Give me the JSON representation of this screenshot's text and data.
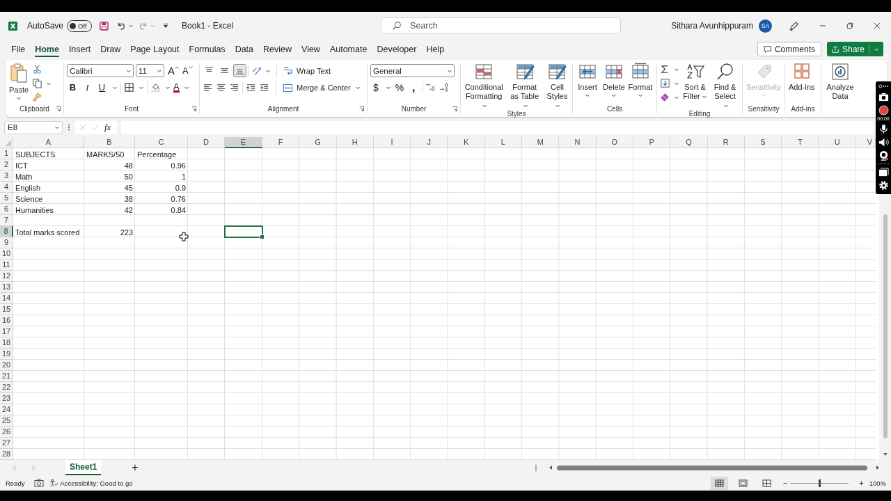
{
  "title_bar": {
    "autosave_label": "AutoSave",
    "autosave": {
      "on": false,
      "text": "Off"
    },
    "document": "Book1  -  Excel",
    "search": {
      "placeholder": "Search"
    },
    "user": "Sithara Avunhippuram",
    "avatar": "SA"
  },
  "menu": {
    "tabs": [
      {
        "label": "File",
        "selected": false
      },
      {
        "label": "Home",
        "selected": true
      },
      {
        "label": "Insert",
        "selected": false
      },
      {
        "label": "Draw",
        "selected": false
      },
      {
        "label": "Page Layout",
        "selected": false
      },
      {
        "label": "Formulas",
        "selected": false
      },
      {
        "label": "Data",
        "selected": false
      },
      {
        "label": "Review",
        "selected": false
      },
      {
        "label": "View",
        "selected": false
      },
      {
        "label": "Automate",
        "selected": false
      },
      {
        "label": "Developer",
        "selected": false
      },
      {
        "label": "Help",
        "selected": false
      }
    ],
    "comments": "Comments",
    "share": "Share"
  },
  "ribbon": {
    "clipboard": {
      "label": "Clipboard",
      "paste": "Paste"
    },
    "font": {
      "label": "Font",
      "name": "Calibri",
      "size": "11",
      "grow": "A",
      "shrink": "A",
      "styles": [
        "B",
        "I",
        "U"
      ],
      "color_letter": "A"
    },
    "alignment": {
      "label": "Alignment",
      "vertical": [
        {
          "selected": false
        },
        {
          "selected": false
        },
        {
          "selected": true
        }
      ],
      "wrap": "Wrap Text",
      "merge": "Merge & Center"
    },
    "number": {
      "label": "Number",
      "format": "General",
      "symbols": [
        "$",
        "%",
        ","
      ]
    },
    "styles": {
      "label": "Styles",
      "buttons": [
        {
          "label": "Conditional Formatting",
          "dropdown": true
        },
        {
          "label": "Format as Table",
          "dropdown": true
        },
        {
          "label": "Cell Styles",
          "dropdown": true
        }
      ]
    },
    "cells": {
      "label": "Cells",
      "buttons": [
        {
          "label": "Insert",
          "dropdown": true
        },
        {
          "label": "Delete",
          "dropdown": true
        },
        {
          "label": "Format",
          "dropdown": true
        }
      ]
    },
    "editing": {
      "label": "Editing",
      "buttons": [
        {
          "label": "Sort & Filter",
          "dropdown": true
        },
        {
          "label": "Find & Select",
          "dropdown": true
        }
      ]
    },
    "sensitivity": {
      "label": "Sensitivity",
      "button": "Sensitivity",
      "disabled": true
    },
    "addins": {
      "label": "Add-ins",
      "button": "Add-ins"
    },
    "analyze": {
      "button": "Analyze Data"
    }
  },
  "formula_bar": {
    "name_box": "E8",
    "fx": "fx"
  },
  "grid": {
    "columns": [
      {
        "label": "A",
        "selected": false
      },
      {
        "label": "B",
        "selected": false
      },
      {
        "label": "C",
        "selected": false
      },
      {
        "label": "D",
        "selected": false
      },
      {
        "label": "E",
        "selected": true
      },
      {
        "label": "F",
        "selected": false
      },
      {
        "label": "G",
        "selected": false
      },
      {
        "label": "H",
        "selected": false
      },
      {
        "label": "I",
        "selected": false
      },
      {
        "label": "J",
        "selected": false
      },
      {
        "label": "K",
        "selected": false
      },
      {
        "label": "L",
        "selected": false
      },
      {
        "label": "M",
        "selected": false
      },
      {
        "label": "N",
        "selected": false
      },
      {
        "label": "O",
        "selected": false
      },
      {
        "label": "P",
        "selected": false
      },
      {
        "label": "Q",
        "selected": false
      },
      {
        "label": "R",
        "selected": false
      },
      {
        "label": "S",
        "selected": false
      },
      {
        "label": "T",
        "selected": false
      },
      {
        "label": "U",
        "selected": false
      },
      {
        "label": "V",
        "selected": false
      }
    ],
    "rows": [
      {
        "number": "1",
        "selected": false,
        "cells": [
          "SUBJECTS",
          "MARKS/50",
          "Percentage"
        ]
      },
      {
        "number": "2",
        "selected": false,
        "cells": [
          "ICT",
          "48",
          "0.96"
        ]
      },
      {
        "number": "3",
        "selected": false,
        "cells": [
          "Math",
          "50",
          "1"
        ]
      },
      {
        "number": "4",
        "selected": false,
        "cells": [
          "English",
          "45",
          "0.9"
        ]
      },
      {
        "number": "5",
        "selected": false,
        "cells": [
          "Science",
          "38",
          "0.76"
        ]
      },
      {
        "number": "6",
        "selected": false,
        "cells": [
          "Humanities",
          "42",
          "0.84"
        ]
      },
      {
        "number": "7",
        "selected": false
      },
      {
        "number": "8",
        "selected": true,
        "cells": [
          "Total marks scored",
          "223"
        ]
      },
      {
        "number": "9",
        "selected": false
      },
      {
        "number": "10",
        "selected": false
      },
      {
        "number": "11",
        "selected": false
      },
      {
        "number": "12",
        "selected": false
      },
      {
        "number": "13",
        "selected": false
      },
      {
        "number": "14",
        "selected": false
      },
      {
        "number": "15",
        "selected": false
      },
      {
        "number": "16",
        "selected": false
      },
      {
        "number": "17",
        "selected": false
      },
      {
        "number": "18",
        "selected": false
      },
      {
        "number": "19",
        "selected": false
      },
      {
        "number": "20",
        "selected": false
      },
      {
        "number": "21",
        "selected": false
      },
      {
        "number": "22",
        "selected": false
      },
      {
        "number": "23",
        "selected": false
      },
      {
        "number": "24",
        "selected": false
      },
      {
        "number": "25",
        "selected": false
      },
      {
        "number": "26",
        "selected": false
      },
      {
        "number": "27",
        "selected": false
      },
      {
        "number": "28",
        "selected": false
      }
    ]
  },
  "sheets": {
    "tabs": [
      {
        "name": "Sheet1",
        "selected": true
      }
    ],
    "add": "+"
  },
  "status_bar": {
    "ready": "Ready",
    "accessibility": "Accessibility: Good to go",
    "views": [
      {
        "selected": true
      },
      {
        "selected": false
      },
      {
        "selected": false
      }
    ],
    "zoom": {
      "level": 0.5,
      "minus": "−",
      "plus": "+",
      "reading": "100%"
    }
  },
  "recorder": {
    "time": "00:00"
  }
}
